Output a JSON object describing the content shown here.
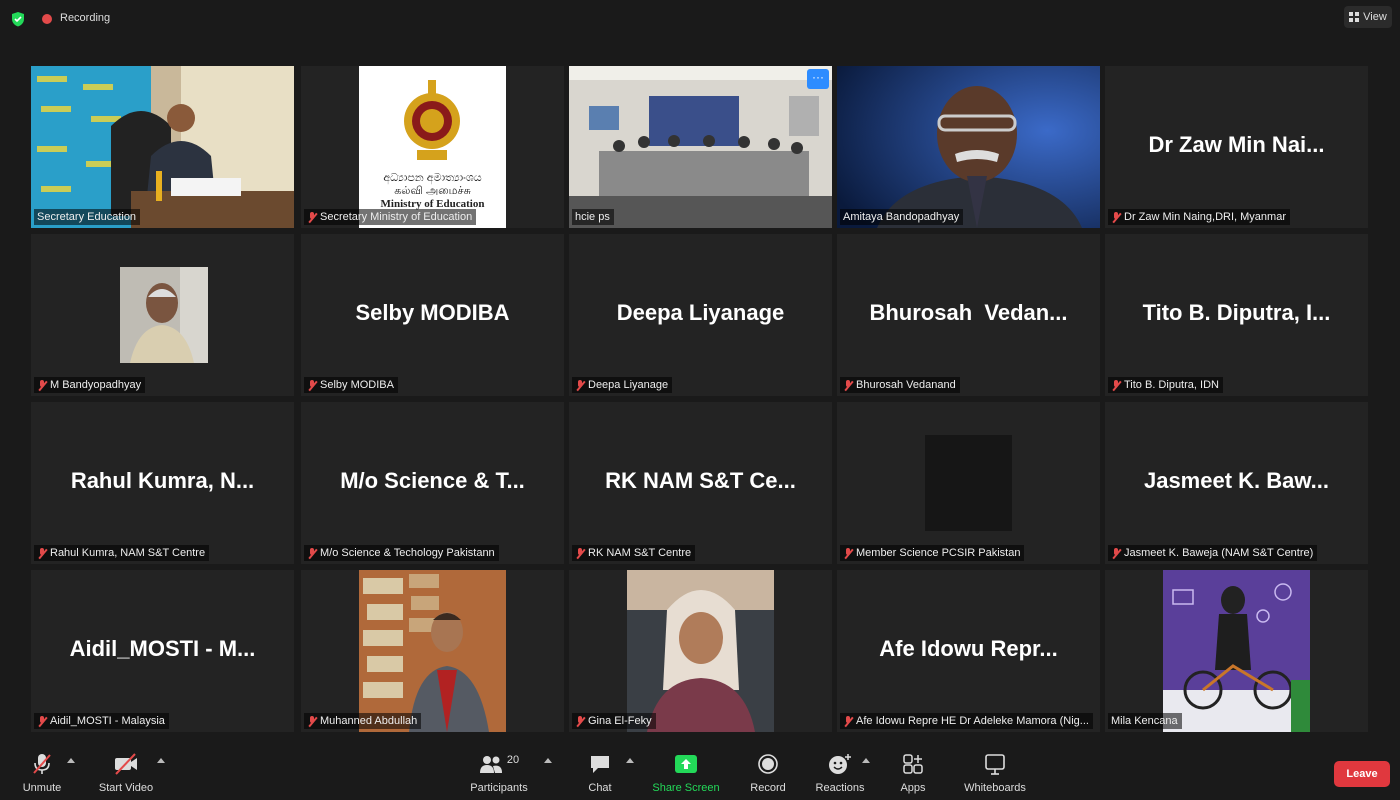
{
  "topbar": {
    "recording_label": "Recording",
    "view_label": "View"
  },
  "tiles": [
    {
      "name": "Secretary Education"
    },
    {
      "name": "Secretary Ministry of Education"
    },
    {
      "name": "hcie ps"
    },
    {
      "name": "Amitaya Bandopadhyay"
    },
    {
      "name": "Dr Zaw Min Naing,DRI, Myanmar",
      "display": "Dr Zaw Min Nai..."
    },
    {
      "name": "M Bandyopadhyay"
    },
    {
      "name": "Selby MODIBA",
      "display": "Selby MODIBA"
    },
    {
      "name": "Deepa Liyanage",
      "display": "Deepa Liyanage"
    },
    {
      "name": "Bhurosah Vedanand",
      "display": "Bhurosah  Vedan..."
    },
    {
      "name": "Tito B. Diputra, IDN",
      "display": "Tito B. Diputra, I..."
    },
    {
      "name": "Rahul Kumra, NAM S&T Centre",
      "display": "Rahul Kumra, N..."
    },
    {
      "name": "M/o Science & Techology Pakistann",
      "display": "M/o Science & T..."
    },
    {
      "name": "RK NAM S&T Centre",
      "display": "RK NAM S&T Ce..."
    },
    {
      "name": "Member Science PCSIR Pakistan"
    },
    {
      "name": "Jasmeet K. Baweja (NAM S&T Centre)",
      "display": "Jasmeet K. Baw..."
    },
    {
      "name": "Aidil_MOSTI - Malaysia",
      "display": "Aidil_MOSTI - M..."
    },
    {
      "name": "Muhanned Abdullah"
    },
    {
      "name": "Gina El-Feky"
    },
    {
      "name": "Afe Idowu Repre HE Dr Adeleke Mamora (Nig...",
      "display": "Afe Idowu Repr..."
    },
    {
      "name": "Mila Kencana"
    }
  ],
  "logo": {
    "line1": "අධ්‍යාපන අමාත්‍යාංශය",
    "line2": "கல்வி அமைச்சு",
    "line3": "Ministry of Education"
  },
  "more_button": "···",
  "toolbar": {
    "unmute": "Unmute",
    "start_video": "Start Video",
    "participants": "Participants",
    "participants_count": "20",
    "chat": "Chat",
    "share_screen": "Share Screen",
    "record": "Record",
    "reactions": "Reactions",
    "apps": "Apps",
    "whiteboards": "Whiteboards",
    "leave": "Leave"
  },
  "colors": {
    "share_green": "#23d959",
    "leave_red": "#e0383e",
    "active_speaker": "#dfe34a",
    "mic_muted": "#e34a4a"
  }
}
